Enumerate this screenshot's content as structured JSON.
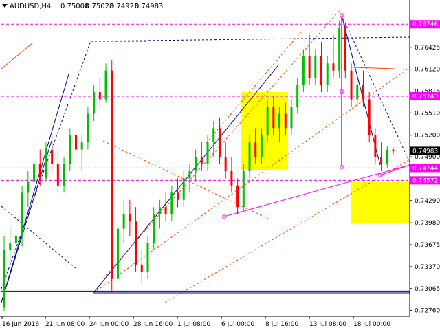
{
  "header": {
    "symbol": "AUDUSD,H4",
    "open": "0.75008",
    "high": "0.75028",
    "low": "0.74923",
    "close": "0.74983"
  },
  "chart_data": {
    "type": "candlestick",
    "ylim": [
      0.7268,
      0.7693
    ],
    "y_ticks": [
      "0.76425",
      "0.76120",
      "0.75815",
      "0.75510",
      "0.75200",
      "0.74900",
      "0.74595",
      "0.74290",
      "0.73980",
      "0.73675",
      "0.73370",
      "0.73065",
      "0.72760"
    ],
    "x_ticks": [
      "16 Jun 2016",
      "21 Jun 08:00",
      "24 Jun 00:00",
      "28 Jun 16:00",
      "1 Jul 08:00",
      "6 Jul 00:00",
      "8 Jul 16:00",
      "13 Jul 08:00",
      "18 Jul 00:00"
    ],
    "price_tags": [
      {
        "value": "0.76746",
        "color": "#ff00ff"
      },
      {
        "value": "0.75743",
        "color": "#ff00ff"
      },
      {
        "value": "0.74983",
        "color": "#000000"
      },
      {
        "value": "0.74744",
        "color": "#ff00ff"
      },
      {
        "value": "0.74572",
        "color": "#ff00ff"
      }
    ],
    "horizontal_levels": [
      {
        "value": 0.76746,
        "color": "#ff00ff"
      },
      {
        "value": 0.75743,
        "color": "#ff00ff"
      },
      {
        "value": 0.74744,
        "color": "#ff00ff"
      },
      {
        "value": 0.74572,
        "color": "#ff00ff"
      },
      {
        "value": 0.7303,
        "color": "#00008b"
      }
    ],
    "candles": [
      [
        0.728,
        0.738,
        0.7275,
        0.736
      ],
      [
        0.736,
        0.7395,
        0.734,
        0.737
      ],
      [
        0.737,
        0.739,
        0.7355,
        0.738
      ],
      [
        0.738,
        0.745,
        0.7365,
        0.744
      ],
      [
        0.744,
        0.747,
        0.742,
        0.7455
      ],
      [
        0.7455,
        0.749,
        0.744,
        0.748
      ],
      [
        0.748,
        0.75,
        0.745,
        0.746
      ],
      [
        0.746,
        0.751,
        0.7455,
        0.75
      ],
      [
        0.75,
        0.752,
        0.747,
        0.748
      ],
      [
        0.748,
        0.75,
        0.744,
        0.745
      ],
      [
        0.745,
        0.749,
        0.744,
        0.748
      ],
      [
        0.748,
        0.753,
        0.747,
        0.752
      ],
      [
        0.752,
        0.754,
        0.749,
        0.75
      ],
      [
        0.75,
        0.752,
        0.747,
        0.751
      ],
      [
        0.751,
        0.756,
        0.75,
        0.755
      ],
      [
        0.755,
        0.759,
        0.754,
        0.758
      ],
      [
        0.758,
        0.76,
        0.756,
        0.757
      ],
      [
        0.757,
        0.762,
        0.7565,
        0.761
      ],
      [
        0.761,
        0.7625,
        0.73,
        0.732
      ],
      [
        0.732,
        0.74,
        0.731,
        0.739
      ],
      [
        0.739,
        0.743,
        0.737,
        0.741
      ],
      [
        0.741,
        0.743,
        0.738,
        0.74
      ],
      [
        0.74,
        0.742,
        0.733,
        0.734
      ],
      [
        0.734,
        0.736,
        0.7315,
        0.733
      ],
      [
        0.733,
        0.738,
        0.732,
        0.737
      ],
      [
        0.737,
        0.742,
        0.736,
        0.741
      ],
      [
        0.741,
        0.743,
        0.739,
        0.742
      ],
      [
        0.742,
        0.744,
        0.74,
        0.741
      ],
      [
        0.741,
        0.745,
        0.74,
        0.744
      ],
      [
        0.744,
        0.746,
        0.742,
        0.743
      ],
      [
        0.743,
        0.747,
        0.742,
        0.746
      ],
      [
        0.746,
        0.748,
        0.744,
        0.747
      ],
      [
        0.747,
        0.75,
        0.7455,
        0.749
      ],
      [
        0.749,
        0.751,
        0.747,
        0.748
      ],
      [
        0.748,
        0.752,
        0.747,
        0.751
      ],
      [
        0.751,
        0.754,
        0.749,
        0.753
      ],
      [
        0.753,
        0.7545,
        0.748,
        0.749
      ],
      [
        0.749,
        0.751,
        0.746,
        0.747
      ],
      [
        0.747,
        0.749,
        0.744,
        0.745
      ],
      [
        0.745,
        0.746,
        0.741,
        0.742
      ],
      [
        0.742,
        0.748,
        0.7415,
        0.747
      ],
      [
        0.747,
        0.752,
        0.746,
        0.751
      ],
      [
        0.751,
        0.753,
        0.748,
        0.749
      ],
      [
        0.749,
        0.753,
        0.748,
        0.752
      ],
      [
        0.752,
        0.757,
        0.751,
        0.756
      ],
      [
        0.756,
        0.7575,
        0.752,
        0.753
      ],
      [
        0.753,
        0.756,
        0.751,
        0.755
      ],
      [
        0.755,
        0.7565,
        0.752,
        0.753
      ],
      [
        0.753,
        0.757,
        0.752,
        0.756
      ],
      [
        0.756,
        0.76,
        0.755,
        0.759
      ],
      [
        0.759,
        0.764,
        0.758,
        0.763
      ],
      [
        0.763,
        0.766,
        0.759,
        0.76
      ],
      [
        0.76,
        0.764,
        0.759,
        0.763
      ],
      [
        0.763,
        0.765,
        0.758,
        0.759
      ],
      [
        0.759,
        0.763,
        0.758,
        0.762
      ],
      [
        0.762,
        0.766,
        0.76,
        0.761
      ],
      [
        0.761,
        0.768,
        0.76,
        0.767
      ],
      [
        0.767,
        0.7675,
        0.76,
        0.761
      ],
      [
        0.761,
        0.762,
        0.756,
        0.757
      ],
      [
        0.757,
        0.76,
        0.756,
        0.759
      ],
      [
        0.759,
        0.761,
        0.756,
        0.757
      ],
      [
        0.757,
        0.758,
        0.751,
        0.752
      ],
      [
        0.752,
        0.753,
        0.748,
        0.749
      ],
      [
        0.749,
        0.751,
        0.747,
        0.748
      ],
      [
        0.748,
        0.7505,
        0.7475,
        0.75
      ],
      [
        0.75,
        0.7503,
        0.7492,
        0.7498
      ]
    ]
  }
}
